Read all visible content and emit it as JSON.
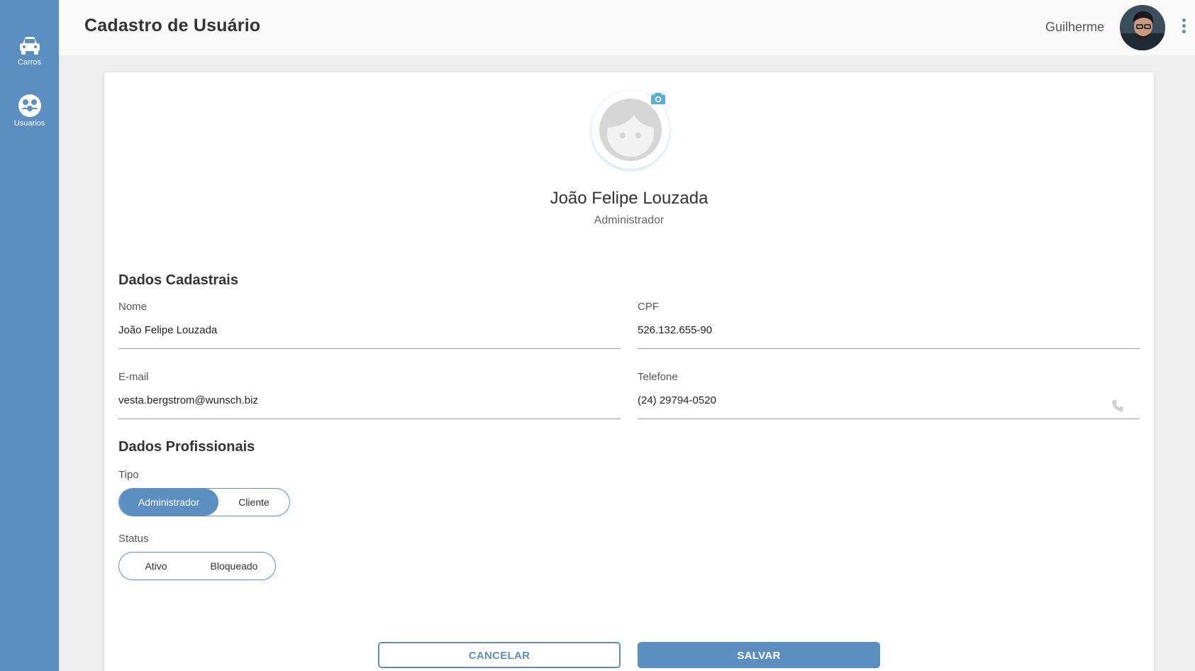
{
  "sidebar": {
    "items": [
      {
        "label": "Carros",
        "icon": "car-icon"
      },
      {
        "label": "Usuarios",
        "icon": "users-icon"
      }
    ]
  },
  "header": {
    "title": "Cadastro de Usuário",
    "user_name": "Guilherme"
  },
  "profile": {
    "name": "João Felipe Louzada",
    "role": "Administrador"
  },
  "dados_cadastrais": {
    "title": "Dados Cadastrais",
    "nome": {
      "label": "Nome",
      "value": "João Felipe Louzada"
    },
    "cpf": {
      "label": "CPF",
      "value": "526.132.655-90"
    },
    "email": {
      "label": "E-mail",
      "value": "vesta.bergstrom@wunsch.biz"
    },
    "telefone": {
      "label": "Telefone",
      "value": "(24) 29794-0520"
    }
  },
  "dados_profissionais": {
    "title": "Dados Profissionais",
    "tipo": {
      "label": "Tipo",
      "options": [
        "Administrador",
        "Cliente"
      ],
      "selected": "Administrador"
    },
    "status": {
      "label": "Status",
      "options": [
        "Ativo",
        "Bloqueado"
      ],
      "selected": ""
    }
  },
  "actions": {
    "cancel_label": "CANCELAR",
    "save_label": "SALVAR"
  },
  "colors": {
    "primary": "#5b8fc2",
    "sidebar": "#5b8fc2",
    "camera_accent": "#5aaed6"
  }
}
